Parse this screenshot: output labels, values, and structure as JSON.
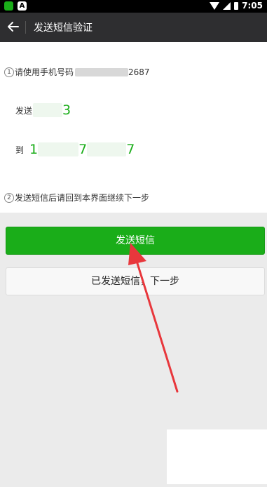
{
  "status_bar": {
    "time": "7:05",
    "badge_letter": "A"
  },
  "header": {
    "title": "发送短信验证"
  },
  "step1": {
    "number": "1",
    "text_prefix": "请使用手机号码",
    "phone_suffix": "2687",
    "send_label": "发送",
    "code_visible": "3",
    "to_label": "到",
    "number_start": "1",
    "number_middle": "7",
    "number_end": "7"
  },
  "step2": {
    "number": "2",
    "text": "发送短信后请回到本界面继续下一步"
  },
  "buttons": {
    "send_sms": "发送短信",
    "sent_next": "已发送短信，下一步"
  },
  "colors": {
    "accent": "#1aad19",
    "arrow": "#e8373c",
    "titlebar": "#2e2e30"
  }
}
